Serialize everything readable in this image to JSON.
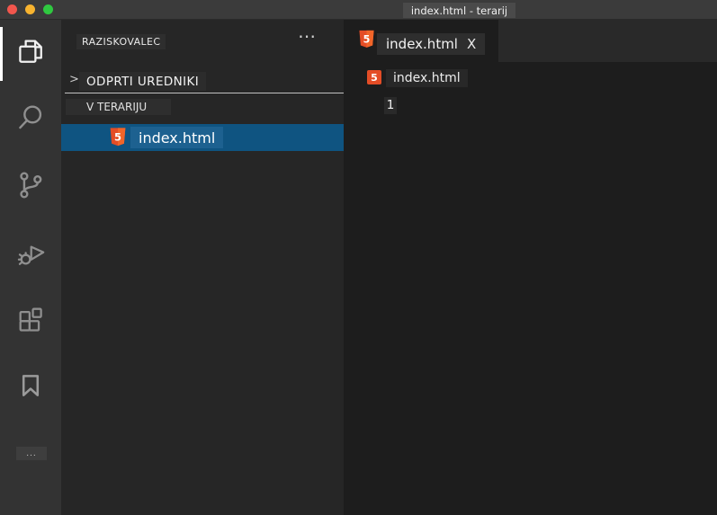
{
  "window": {
    "title": "index.html - terarij"
  },
  "window_controls": {
    "close_color": "#f2564d",
    "minimize_color": "#f7b32f",
    "zoom_color": "#2fc840"
  },
  "activity_bar": {
    "items": [
      {
        "id": "explorer",
        "active": true
      },
      {
        "id": "search",
        "active": false
      },
      {
        "id": "source-control",
        "active": false
      },
      {
        "id": "run-and-debug",
        "active": false
      },
      {
        "id": "extensions",
        "active": false
      },
      {
        "id": "bookmarks",
        "active": false
      }
    ],
    "overflow_label": "..."
  },
  "sidebar": {
    "title": "RAZISKOVALEC",
    "more_actions_label": "⋯",
    "open_editors": {
      "chevron": ">",
      "label": "ODPRTI UREDNIKI"
    },
    "folder_section": {
      "label": "V TERARIJU"
    },
    "file": {
      "name": "index.html",
      "type": "html",
      "selected": true
    }
  },
  "editor": {
    "tab": {
      "label": "index.html",
      "close": "X",
      "active": true
    },
    "breadcrumb": {
      "icon_label": "5",
      "file": "index.html"
    },
    "lines": [
      {
        "number": "1",
        "content": ""
      }
    ]
  },
  "colors": {
    "titlebar_bg": "#3b3b3b",
    "activity_bar_bg": "#333333",
    "sidebar_bg": "#262626",
    "editor_bg": "#1d1d1d",
    "tab_strip_bg": "#292929",
    "selection_bg": "#0f5481",
    "selection_highlight_bg": "#1d6190",
    "html5_orange": "#e44d26",
    "html5_orange_light": "#f16529"
  }
}
